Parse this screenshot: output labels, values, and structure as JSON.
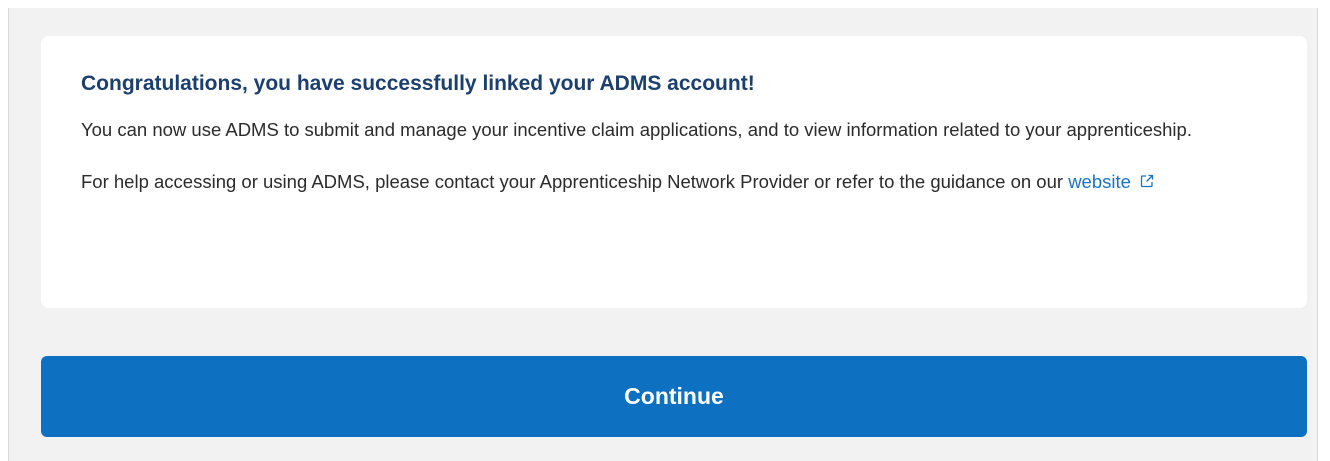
{
  "card": {
    "title": "Congratulations, you have successfully linked your ADMS account!",
    "paragraph1": "You can now use ADMS to submit and manage your incentive claim applications, and to view information related to your apprenticeship.",
    "paragraph2_prefix": "For help accessing or using ADMS, please contact your Apprenticeship Network Provider or refer to the guidance on our ",
    "link_label": "website",
    "link_icon": "external-link-icon"
  },
  "actions": {
    "continue_label": "Continue"
  },
  "colors": {
    "title": "#1b3f6e",
    "link": "#1a73c2",
    "button": "#0d70c0",
    "background": "#f2f2f2"
  }
}
